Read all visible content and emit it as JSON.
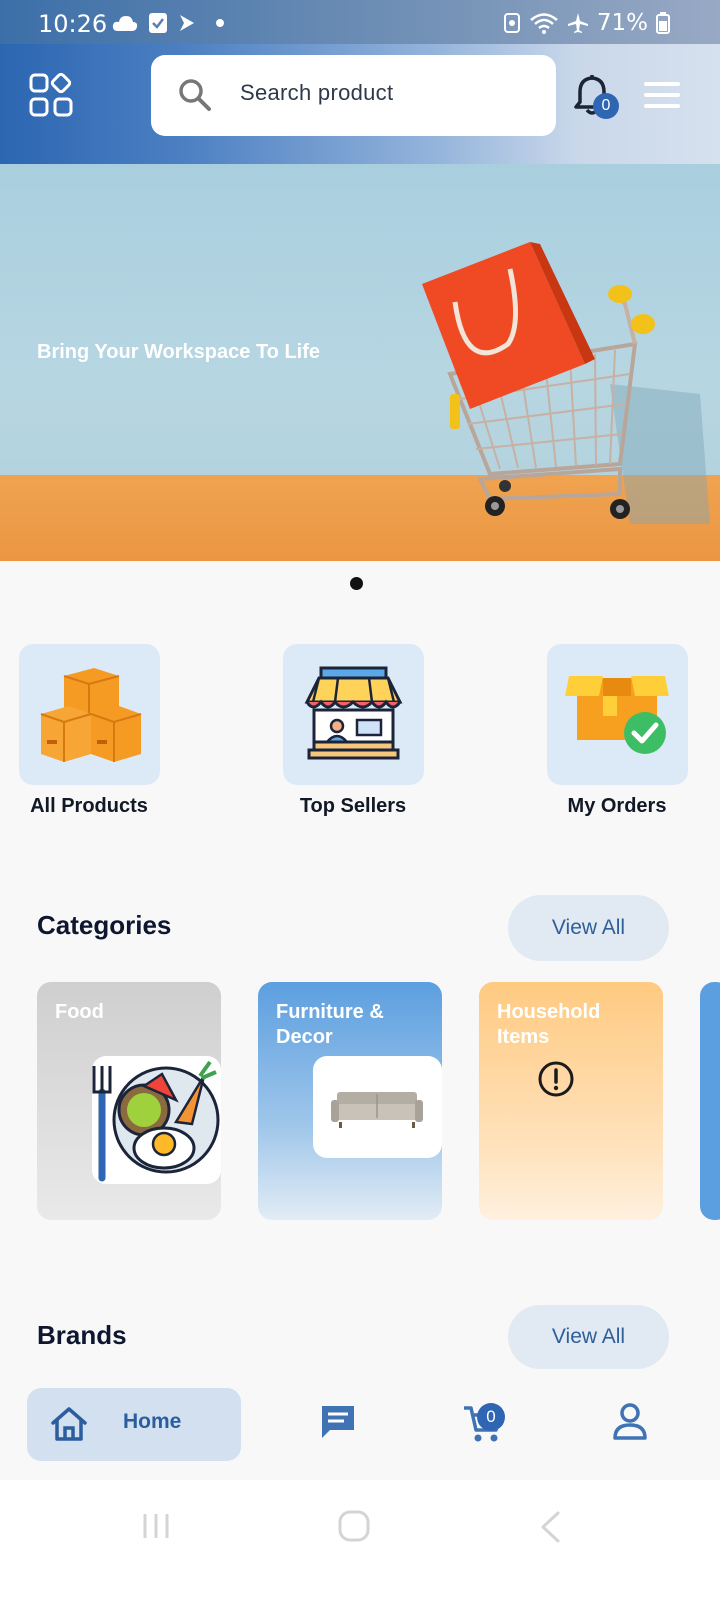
{
  "status_bar": {
    "time": "10:26",
    "battery": "71%"
  },
  "header": {
    "search_placeholder": "Search product",
    "notification_count": "0"
  },
  "banner": {
    "title": "Bring Your Workspace To Life"
  },
  "quick_actions": [
    {
      "label": "All Products",
      "icon": "boxes-icon"
    },
    {
      "label": "Top Sellers",
      "icon": "storefront-icon"
    },
    {
      "label": "My Orders",
      "icon": "order-box-check-icon"
    }
  ],
  "categories": {
    "title": "Categories",
    "view_all": "View All",
    "items": [
      {
        "name": "Food"
      },
      {
        "name": "Furniture & Decor"
      },
      {
        "name": "Household Items"
      }
    ]
  },
  "brands": {
    "title": "Brands",
    "view_all": "View All"
  },
  "bottom_nav": {
    "home_label": "Home",
    "cart_count": "0"
  },
  "colors": {
    "accent": "#2f66b3",
    "tile_bg": "#dceaf7"
  }
}
